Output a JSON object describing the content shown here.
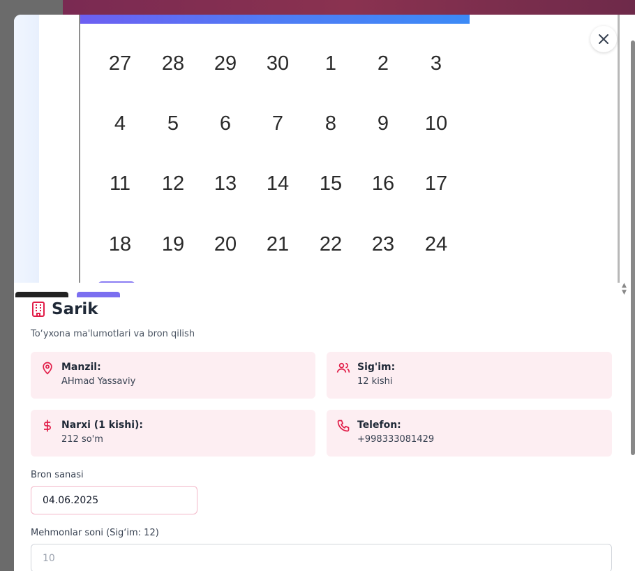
{
  "calendar_image": {
    "weeks": [
      [
        "27",
        "28",
        "29",
        "30",
        "1",
        "2",
        "3"
      ],
      [
        "4",
        "5",
        "6",
        "7",
        "8",
        "9",
        "10"
      ],
      [
        "11",
        "12",
        "13",
        "14",
        "15",
        "16",
        "17"
      ],
      [
        "18",
        "19",
        "20",
        "21",
        "22",
        "23",
        "24"
      ]
    ]
  },
  "venue": {
    "title": "Sarik",
    "subtitle": "To‘yxona ma'lumotlari va bron qilish"
  },
  "cards": {
    "address": {
      "label": "Manzil:",
      "value": "AHmad Yassaviy",
      "icon": "map-pin-icon"
    },
    "capacity": {
      "label": "Sig'im:",
      "value": "12 kishi",
      "icon": "users-icon"
    },
    "price": {
      "label": "Narxi (1 kishi):",
      "value": "212 so'm",
      "icon": "dollar-icon"
    },
    "phone": {
      "label": "Telefon:",
      "value": "+998333081429",
      "icon": "phone-icon"
    }
  },
  "form": {
    "date_label": "Bron sanasi",
    "date_value": "04.06.2025",
    "guests_label": "Mehmonlar soni (Sig‘im: 12)",
    "guests_placeholder": "10"
  },
  "colors": {
    "accent": "#e11d48",
    "card_bg": "#fdeef2",
    "calendar_header": "#4f7cf5"
  }
}
